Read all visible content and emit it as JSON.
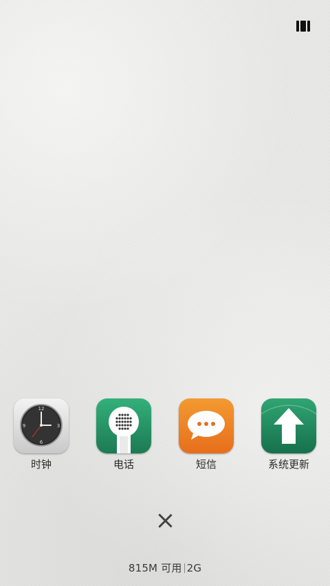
{
  "apps": [
    {
      "label": "时钟",
      "icon": "clock-icon"
    },
    {
      "label": "电话",
      "icon": "phone-icon"
    },
    {
      "label": "短信",
      "icon": "message-icon"
    },
    {
      "label": "系统更新",
      "icon": "update-icon"
    }
  ],
  "status": {
    "memory": "815M 可用",
    "network": "2G"
  },
  "controls": {
    "close": "close-icon",
    "layout": "grid-layout-icon"
  }
}
